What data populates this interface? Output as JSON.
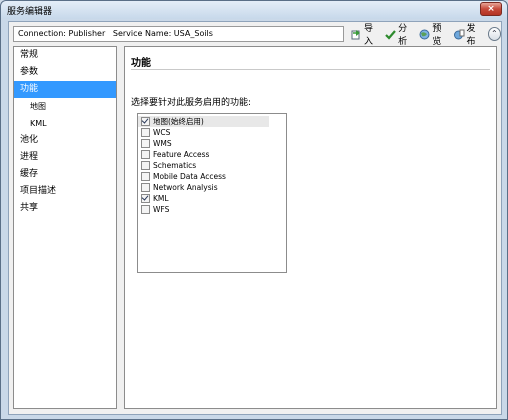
{
  "window": {
    "title": "服务编辑器",
    "close_label": "×"
  },
  "connection_text": "Connection: Publisher   Service Name: USA_Soils",
  "toolbar": {
    "import_label": "导入",
    "analyze_label": "分析",
    "preview_label": "预览",
    "publish_label": "发布",
    "collapse_label": "⌃"
  },
  "sidebar": {
    "items": [
      {
        "label": "常规"
      },
      {
        "label": "参数"
      },
      {
        "label": "功能"
      },
      {
        "label": "地图"
      },
      {
        "label": "KML"
      },
      {
        "label": "池化"
      },
      {
        "label": "进程"
      },
      {
        "label": "缓存"
      },
      {
        "label": "项目描述"
      },
      {
        "label": "共享"
      }
    ]
  },
  "main": {
    "heading": "功能",
    "prompt": "选择要针对此服务启用的功能:",
    "capabilities": [
      {
        "label": "地图(始终启用)",
        "checked": true
      },
      {
        "label": "WCS",
        "checked": false
      },
      {
        "label": "WMS",
        "checked": false
      },
      {
        "label": "Feature Access",
        "checked": false
      },
      {
        "label": "Schematics",
        "checked": false
      },
      {
        "label": "Mobile Data Access",
        "checked": false
      },
      {
        "label": "Network Analysis",
        "checked": false
      },
      {
        "label": "KML",
        "checked": true
      },
      {
        "label": "WFS",
        "checked": false
      }
    ]
  },
  "colors": {
    "selection": "#3399ff",
    "window_frame": "#c9d8e8"
  }
}
